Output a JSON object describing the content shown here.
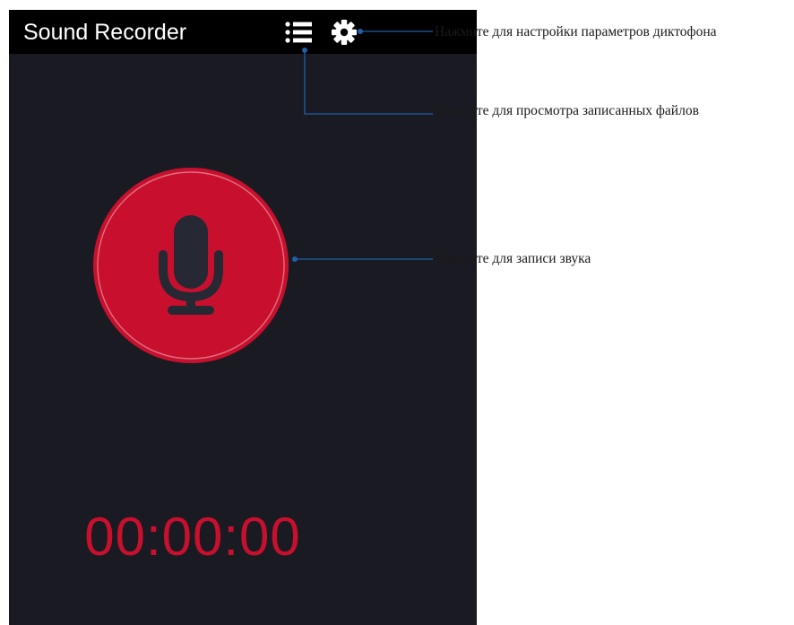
{
  "app": {
    "title": "Sound Recorder",
    "timer": "00:00:00"
  },
  "icons": {
    "list": "list-icon",
    "settings": "gear-icon",
    "record": "microphone-icon"
  },
  "callouts": {
    "settings": "Нажмите для настройки параметров диктофона",
    "files": "Нажмите для просмотра записанных файлов",
    "record": "Нажмите для записи звука"
  },
  "colors": {
    "appbar": "#000000",
    "background": "#1a1b22",
    "record_button": "#c8102e",
    "timer": "#c8102e",
    "callout_line": "#1f5fa8"
  }
}
